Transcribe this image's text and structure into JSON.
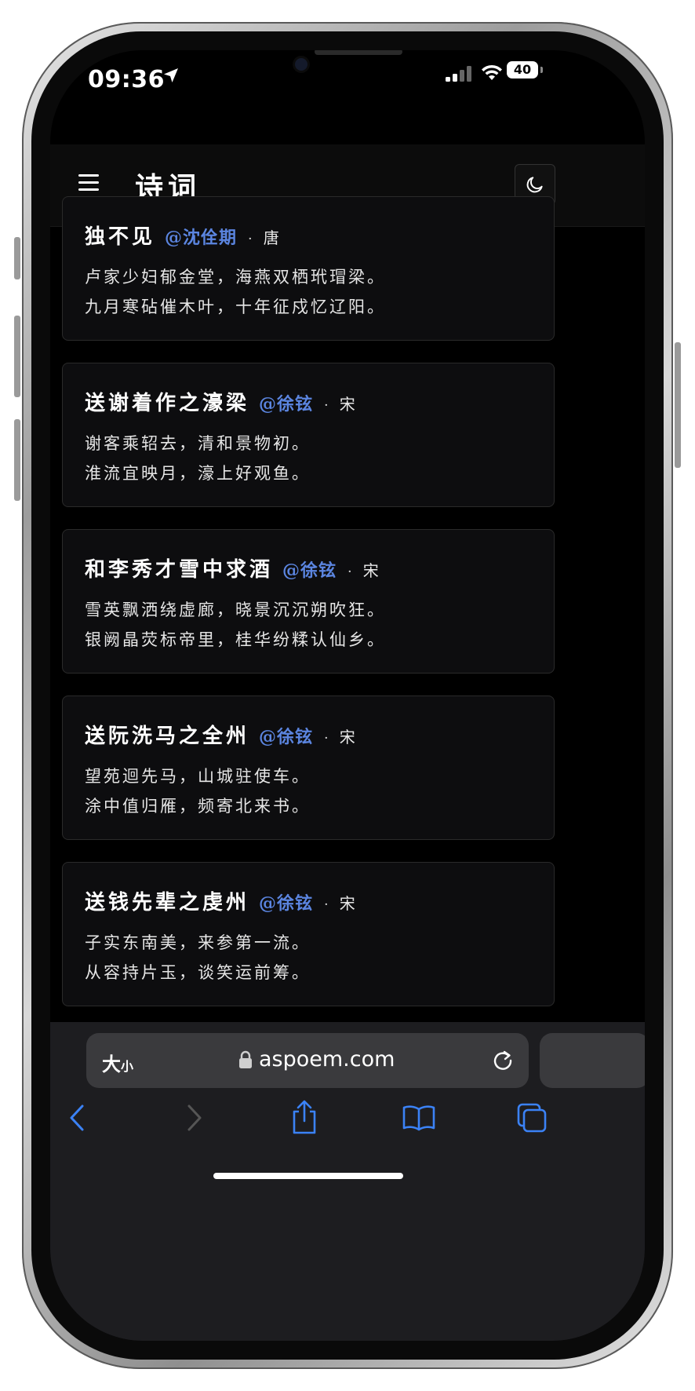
{
  "status_bar": {
    "time": "09:36",
    "battery": "40"
  },
  "header": {
    "title": "诗词"
  },
  "poems": [
    {
      "title": "独不见",
      "poet": "@沈佺期",
      "dynasty": "唐",
      "lines": [
        "卢家少妇郁金堂，海燕双栖玳瑁梁。",
        "九月寒砧催木叶，十年征戍忆辽阳。"
      ]
    },
    {
      "title": "送谢着作之濠梁",
      "poet": "@徐铉",
      "dynasty": "宋",
      "lines": [
        "谢客乘轺去，清和景物初。",
        "淮流宜映月，濠上好观鱼。"
      ]
    },
    {
      "title": "和李秀才雪中求酒",
      "poet": "@徐铉",
      "dynasty": "宋",
      "lines": [
        "雪英飘洒绕虚廊，晓景沉沉朔吹狂。",
        "银阙晶荧标帝里，桂华纷糅认仙乡。"
      ]
    },
    {
      "title": "送阮洗马之全州",
      "poet": "@徐铉",
      "dynasty": "宋",
      "lines": [
        "望苑迴先马，山城驻使车。",
        "涂中值归雁，频寄北来书。"
      ]
    },
    {
      "title": "送钱先辈之虔州",
      "poet": "@徐铉",
      "dynasty": "宋",
      "lines": [
        "子实东南美，来参第一流。",
        "从容持片玉，谈笑运前筹。"
      ]
    }
  ],
  "separator": "·",
  "browser": {
    "text_size_big": "大",
    "text_size_small": "小",
    "url": "aspoem.com"
  },
  "icons": {
    "status": [
      "location-arrow-icon",
      "cellular-signal-icon",
      "wifi-icon",
      "battery-icon"
    ],
    "app": [
      "hamburger-menu-icon",
      "moon-icon"
    ],
    "browser": [
      "lock-icon",
      "reload-icon",
      "back-icon",
      "forward-icon",
      "share-icon",
      "bookmarks-icon",
      "tabs-icon"
    ]
  },
  "colors": {
    "background": "#000000",
    "card": "#0d0d0f",
    "poet_link": "#5b85e0",
    "safari_accent": "#3b82f6"
  }
}
